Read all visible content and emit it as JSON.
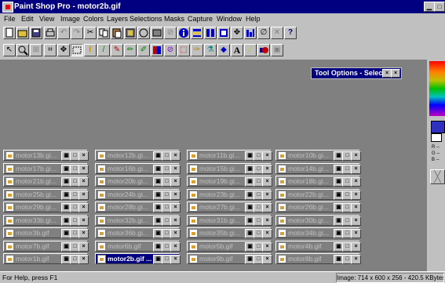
{
  "window": {
    "title": "Paint Shop Pro - motor2b.gif",
    "controls": [
      "minimize",
      "maximize"
    ]
  },
  "menubar": {
    "items": [
      "File",
      "Edit",
      "View",
      "Image",
      "Colors",
      "Layers",
      "Selections",
      "Masks",
      "Capture",
      "Window",
      "Help"
    ]
  },
  "toolbar_main": {
    "buttons": [
      "new-icon",
      "open-icon",
      "save-icon",
      "print-icon",
      "undo-icon",
      "redo-icon",
      "cut-icon",
      "copy-icon",
      "paste-icon",
      "paste-new-icon",
      "screen-capture-icon",
      "browse-icon",
      "twain-icon",
      "info-icon",
      "layer-palette-icon",
      "tool-palette-icon",
      "color-palette-icon",
      "overview-icon",
      "histogram-icon",
      "help-icon"
    ]
  },
  "toolbar_tools": {
    "buttons": [
      "arrow-tool-icon",
      "zoom-tool-icon",
      "deformation-tool-icon",
      "crop-tool-icon",
      "mover-tool-icon",
      "selection-tool-icon",
      "freehand-tool-icon",
      "magic-wand-tool-icon",
      "dropper-tool-icon",
      "paintbrush-tool-icon",
      "clone-brush-tool-icon",
      "color-replacer-tool-icon",
      "retouch-tool-icon",
      "eraser-tool-icon",
      "picture-tube-tool-icon",
      "airbrush-tool-icon",
      "flood-fill-tool-icon",
      "text-tool-icon",
      "draw-tool-icon",
      "preset-shapes-tool-icon",
      "object-selector-icon"
    ]
  },
  "tool_options": {
    "title": "Tool Options - Select",
    "controls": [
      "window-close-icon",
      "window-close-icon"
    ]
  },
  "minimized_windows": [
    [
      "motor13b.gi...",
      "motor12b.gi...",
      "motor11b.gi...",
      "motor10b.gi..."
    ],
    [
      "motor17b.gi...",
      "motor16b.gi...",
      "motor15b.gi...",
      "motor14b.gi..."
    ],
    [
      "motor21b.gi...",
      "motor20b.gi...",
      "motor19b.gi...",
      "motor18b.gi..."
    ],
    [
      "motor25b.gi...",
      "motor24b.gi...",
      "motor23b.gi...",
      "motor22b.gi..."
    ],
    [
      "motor29b.gi...",
      "motor28b.gi...",
      "motor27b.gi...",
      "motor26b.gi..."
    ],
    [
      "motor33b.gi...",
      "motor32b.gi...",
      "motor31b.gi...",
      "motor30b.gi..."
    ],
    [
      "motor3b.gif",
      "motor36b.gi...",
      "motor35b.gi...",
      "motor34b.gi..."
    ],
    [
      "motor7b.gif",
      "motor6b.gif",
      "motor5b.gif",
      "motor4b.gif"
    ],
    [
      "motor1b.gif",
      "motor2b.gif ...",
      "motor9b.gif",
      "motor8b.gif"
    ]
  ],
  "active_window": "motor2b.gif ...",
  "window_button_glyphs": {
    "restore": "▣",
    "maximize": "□",
    "close": "×"
  },
  "color_panel": {
    "labels": [
      "R --",
      "G --",
      "B --"
    ],
    "colors": {
      "active_fg": "#3030c0"
    }
  },
  "statusbar": {
    "help": "For Help, press F1",
    "info": "Image:  714 x 600 x 256 - 420.5 KBytes"
  },
  "colors": {
    "title_bar": "#000080",
    "workspace": "#808080",
    "chrome": "#c0c0c0"
  }
}
